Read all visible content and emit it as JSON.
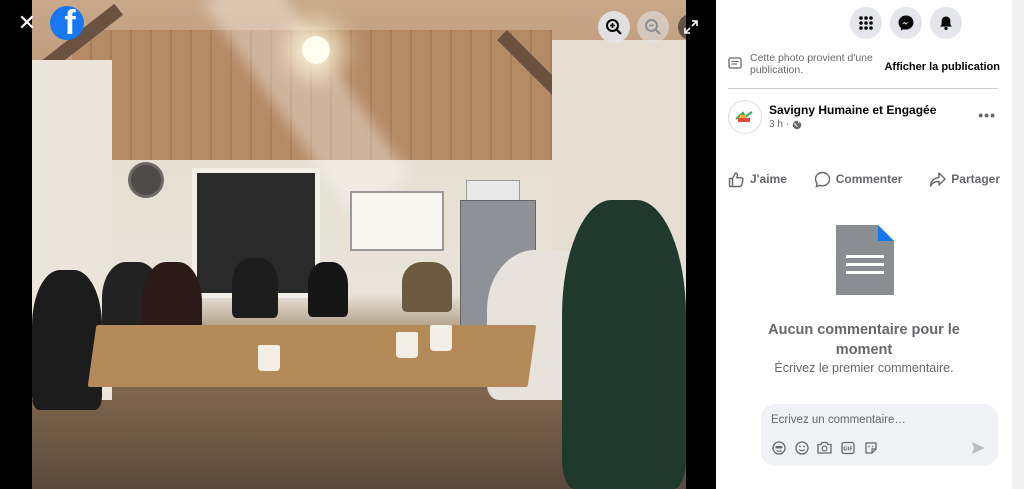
{
  "viewer": {
    "close_symbol": "✕",
    "brand": "f",
    "controls": [
      "zoom-in-icon",
      "zoom-out-icon",
      "expand-icon"
    ]
  },
  "header_icons": [
    "menu-grid-icon",
    "messenger-icon",
    "bell-icon"
  ],
  "notice": {
    "text": "Cette photo provient d'une publication.",
    "link": "Afficher la publication"
  },
  "post": {
    "page_name": "Savigny Humaine et Engagée",
    "time": "3 h",
    "audience_icon": "globe-icon",
    "more": "•••"
  },
  "actions": {
    "like": "J'aime",
    "comment": "Commenter",
    "share": "Partager"
  },
  "comments": {
    "empty_title": "Aucun commentaire pour le moment",
    "empty_subtitle": "Écrivez le premier commentaire.",
    "placeholder": "Écrivez un commentaire…",
    "input_icons": [
      "avatar-sticker-icon",
      "emoji-icon",
      "camera-icon",
      "gif-icon",
      "sticker-icon"
    ]
  },
  "colors": {
    "brand": "#1877f2",
    "secondary_text": "#65676b",
    "comment_bg": "#f0f2f5"
  }
}
